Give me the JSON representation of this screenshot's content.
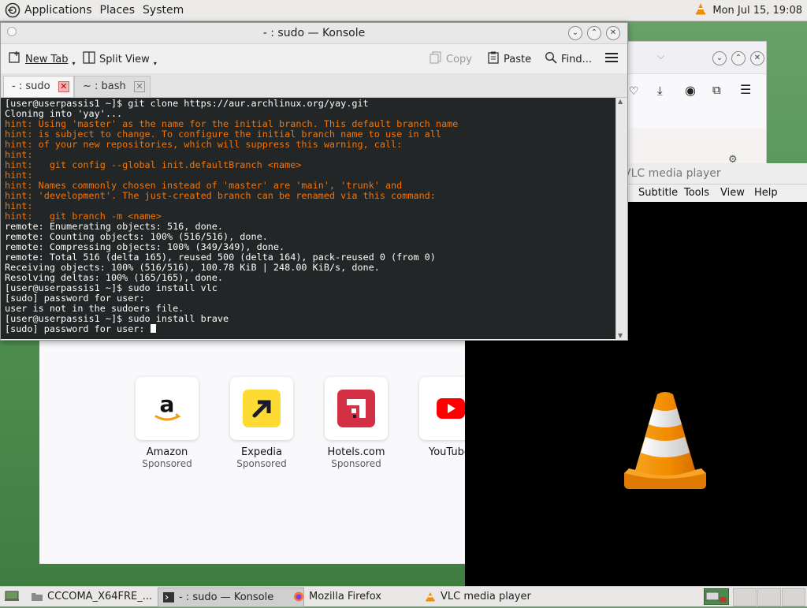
{
  "top_panel": {
    "menus": [
      "Applications",
      "Places",
      "System"
    ],
    "clock": "Mon Jul 15, 19:08"
  },
  "konsole": {
    "title": "- : sudo — Konsole",
    "toolbar": {
      "new_tab": "New Tab",
      "split_view": "Split View",
      "copy": "Copy",
      "paste": "Paste",
      "find": "Find..."
    },
    "tabs": [
      {
        "label": "- : sudo",
        "active": true
      },
      {
        "label": "~ : bash",
        "active": false
      }
    ],
    "terminal": {
      "line_1": "[user@userpassis1 ~]$ git clone https://aur.archlinux.org/yay.git",
      "line_2": "Cloning into 'yay'...",
      "hint_1": "hint: Using 'master' as the name for the initial branch. This default branch name",
      "hint_2": "hint: is subject to change. To configure the initial branch name to use in all",
      "hint_3": "hint: of your new repositories, which will suppress this warning, call:",
      "hint_4": "hint:",
      "hint_5": "hint:   git config --global init.defaultBranch <name>",
      "hint_6": "hint:",
      "hint_7": "hint: Names commonly chosen instead of 'master' are 'main', 'trunk' and",
      "hint_8": "hint: 'development'. The just-created branch can be renamed via this command:",
      "hint_9": "hint:",
      "hint_10": "hint:   git branch -m <name>",
      "line_3": "remote: Enumerating objects: 516, done.",
      "line_4": "remote: Counting objects: 100% (516/516), done.",
      "line_5": "remote: Compressing objects: 100% (349/349), done.",
      "line_6": "remote: Total 516 (delta 165), reused 500 (delta 164), pack-reused 0 (from 0)",
      "line_7": "Receiving objects: 100% (516/516), 100.78 KiB | 248.00 KiB/s, done.",
      "line_8": "Resolving deltas: 100% (165/165), done.",
      "line_9": "[user@userpassis1 ~]$ sudo install vlc",
      "line_10": "[sudo] password for user:",
      "line_11": "user is not in the sudoers file.",
      "line_12": "[user@userpassis1 ~]$ sudo install brave",
      "line_13": "[sudo] password for user: "
    }
  },
  "firefox": {
    "tiles": [
      {
        "name": "Amazon",
        "sub": "Sponsored"
      },
      {
        "name": "Expedia",
        "sub": "Sponsored"
      },
      {
        "name": "Hotels.com",
        "sub": "Sponsored"
      },
      {
        "name": "YouTube",
        "sub": ""
      }
    ]
  },
  "vlc": {
    "title": "VLC media player",
    "menus": [
      "Subtitle",
      "Tools",
      "View",
      "Help"
    ]
  },
  "taskbar": {
    "tasks": [
      {
        "label": "CCCOMA_X64FRE_...",
        "icon": "folder-icon"
      },
      {
        "label": "- : sudo — Konsole",
        "icon": "terminal-icon"
      },
      {
        "label": "Mozilla Firefox",
        "icon": "firefox-icon"
      },
      {
        "label": "VLC media player",
        "icon": "vlc-icon"
      }
    ]
  },
  "colors": {
    "terminal_bg": "#232627",
    "terminal_fg": "#fcfcfc",
    "hint": "#f67400",
    "vlc_orange": "#f28c00"
  }
}
